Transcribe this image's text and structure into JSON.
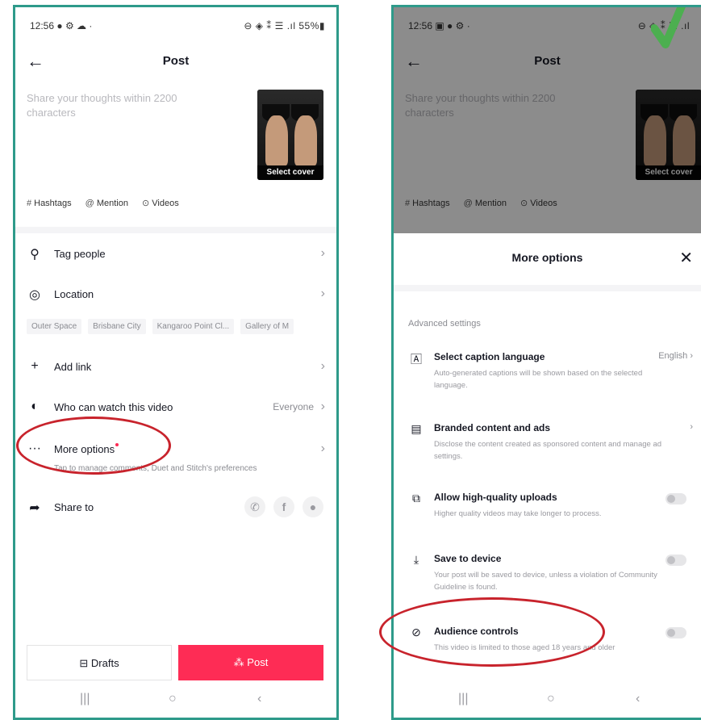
{
  "left": {
    "status": {
      "time": "12:56 ● ⚙ ☁ ·",
      "right": "⊖ ◈ ⁑ ☰ .ıl 55%▮"
    },
    "title": "Post",
    "caption_placeholder": "Share your thoughts within 2200 characters",
    "cover_label": "Select cover",
    "chips": [
      {
        "sym": "#",
        "label": "Hashtags"
      },
      {
        "sym": "@",
        "label": "Mention"
      },
      {
        "sym": "⊙",
        "label": "Videos"
      }
    ],
    "tag_people": "Tag people",
    "location": "Location",
    "location_chips": [
      "Outer Space",
      "Brisbane City",
      "Kangaroo Point Cl...",
      "Gallery of M"
    ],
    "add_link": "Add link",
    "who_can_watch": "Who can watch this video",
    "who_value": "Everyone",
    "more_options": "More options",
    "more_options_hint": "Tap to manage comments, Duet and Stitch's preferences",
    "share_to": "Share to",
    "drafts": "Drafts",
    "post": "Post"
  },
  "right": {
    "status": {
      "time": "12:56 ▣ ● ⚙ ·",
      "right": "⊖ ◈ ⁑ ☰ .ıl"
    },
    "title": "Post",
    "caption_placeholder": "Share your thoughts within 2200 characters",
    "cover_label": "Select cover",
    "chips": [
      {
        "sym": "#",
        "label": "Hashtags"
      },
      {
        "sym": "@",
        "label": "Mention"
      },
      {
        "sym": "⊙",
        "label": "Videos"
      }
    ],
    "sheet_title": "More options",
    "section": "Advanced settings",
    "options": [
      {
        "label": "Select caption language",
        "value": "English",
        "desc": "Auto-generated captions will be shown based on the selected language."
      },
      {
        "label": "Branded content and ads",
        "desc": "Disclose the content created as sponsored content and manage ad settings."
      },
      {
        "label": "Allow high-quality uploads",
        "desc": "Higher quality videos may take longer to process."
      },
      {
        "label": "Save to device",
        "desc": "Your post will be saved to device, unless a violation of Community Guideline is found."
      },
      {
        "label": "Audience controls",
        "desc": "This video is limited to those aged 18 years and older"
      }
    ]
  },
  "colors": {
    "accent": "#fe2c55",
    "frame": "#2e9a8a",
    "highlight": "#c8232c",
    "check": "#4caf50"
  }
}
